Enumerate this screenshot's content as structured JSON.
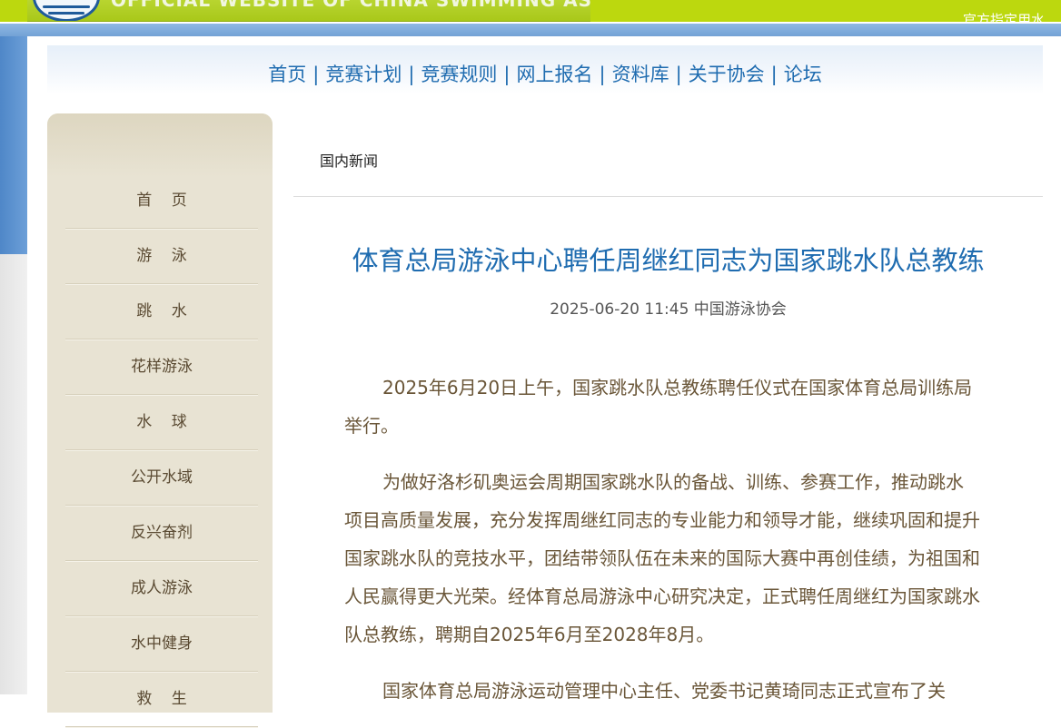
{
  "header": {
    "logo_text": "OFFICIAL WEBSITE OF CHINA SWIMMING ASSOCIATION",
    "banner_note": "官方指定用水"
  },
  "topnav": {
    "items": [
      {
        "label": "首页"
      },
      {
        "label": "竞赛计划"
      },
      {
        "label": "竞赛规则"
      },
      {
        "label": "网上报名"
      },
      {
        "label": "资料库"
      },
      {
        "label": "关于协会"
      },
      {
        "label": "论坛"
      }
    ],
    "separator": "|"
  },
  "sidebar": {
    "items": [
      {
        "label": "首    页"
      },
      {
        "label": "游    泳"
      },
      {
        "label": "跳    水"
      },
      {
        "label": "花样游泳"
      },
      {
        "label": "水    球"
      },
      {
        "label": "公开水域"
      },
      {
        "label": "反兴奋剂"
      },
      {
        "label": "成人游泳"
      },
      {
        "label": "水中健身"
      },
      {
        "label": "救    生"
      }
    ]
  },
  "breadcrumb": "国内新闻",
  "article": {
    "title": "体育总局游泳中心聘任周继红同志为国家跳水队总教练",
    "meta": "2025-06-20 11:45 中国游泳协会",
    "paragraphs": [
      "2025年6月20日上午，国家跳水队总教练聘任仪式在国家体育总局训练局举行。",
      "为做好洛杉矶奥运会周期国家跳水队的备战、训练、参赛工作，推动跳水项目高质量发展，充分发挥周继红同志的专业能力和领导才能，继续巩固和提升国家跳水队的竞技水平，团结带领队伍在未来的国际大赛中再创佳绩，为祖国和人民赢得更大光荣。经体育总局游泳中心研究决定，正式聘任周继红为国家跳水队总教练，聘期自2025年6月至2028年8月。",
      "国家体育总局游泳运动管理中心主任、党委书记黄琦同志正式宣布了关"
    ]
  },
  "colors": {
    "banner_green": "#bcd80e",
    "link_blue": "#1f6cb0",
    "sidebar_bg": "#e8e3d3",
    "body_text": "#6a5638"
  }
}
